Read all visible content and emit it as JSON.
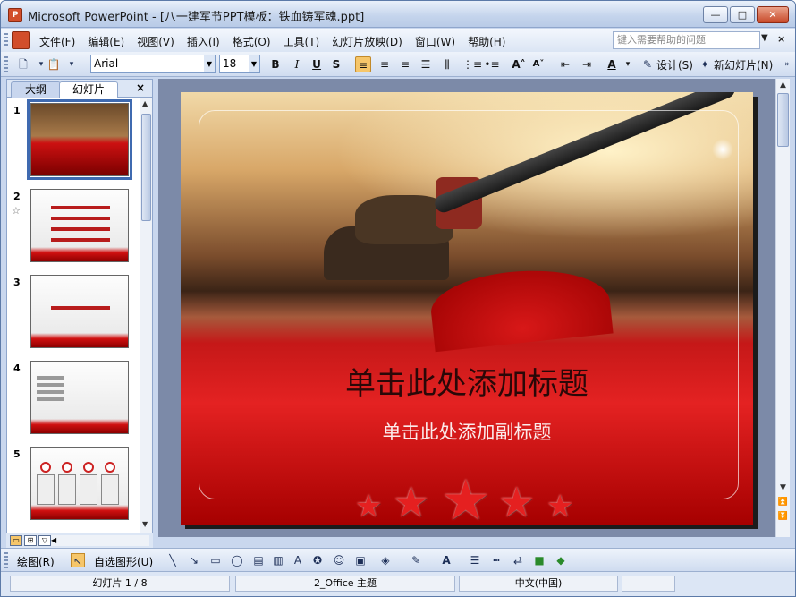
{
  "window": {
    "title": "Microsoft PowerPoint - [八一建军节PPT模板：铁血铸军魂.ppt]",
    "minimize": "—",
    "maximize": "□",
    "close": "✕"
  },
  "menu": {
    "items": [
      "文件(F)",
      "编辑(E)",
      "视图(V)",
      "插入(I)",
      "格式(O)",
      "工具(T)",
      "幻灯片放映(D)",
      "窗口(W)",
      "帮助(H)"
    ],
    "help_placeholder": "键入需要帮助的问题"
  },
  "toolbar": {
    "font": "Arial",
    "size": "18",
    "bold": "B",
    "italic": "I",
    "underline": "U",
    "shadow": "S",
    "design_label": "设计(S)",
    "new_slide_label": "新幻灯片(N)"
  },
  "left_panel": {
    "tab_outline": "大纲",
    "tab_slides": "幻灯片",
    "close": "×",
    "slides": [
      {
        "number": "1"
      },
      {
        "number": "2"
      },
      {
        "number": "3"
      },
      {
        "number": "4"
      },
      {
        "number": "5"
      }
    ]
  },
  "slide": {
    "title": "单击此处添加标题",
    "subtitle": "单击此处添加副标题"
  },
  "drawbar": {
    "draw_label": "绘图(R)",
    "autoshapes_label": "自选图形(U)"
  },
  "status": {
    "slide_info": "幻灯片 1 / 8",
    "theme": "2_Office 主题",
    "language": "中文(中国)"
  },
  "colors": {
    "accent": "#3f6ab0",
    "slide_red": "#d01010",
    "title_text": "#2a0808"
  }
}
